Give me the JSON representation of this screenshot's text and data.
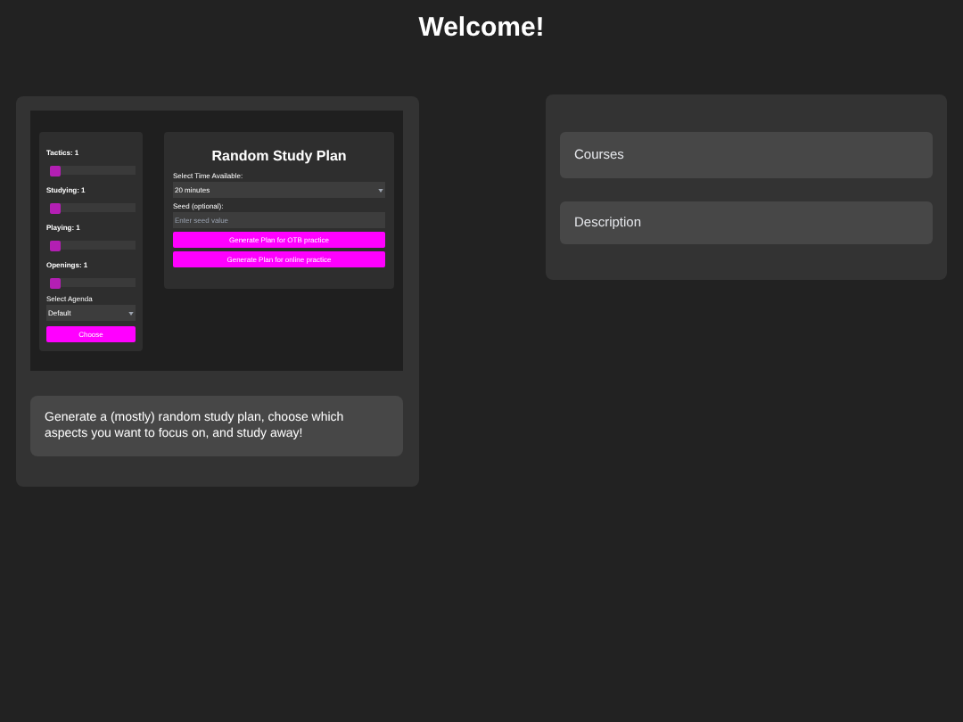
{
  "heading": "Welcome!",
  "preview": {
    "sliders": [
      {
        "label": "Tactics: 1",
        "level": 0
      },
      {
        "label": "Studying: 1",
        "level": 0
      },
      {
        "label": "Playing: 1",
        "level": 0
      },
      {
        "label": "Openings: 1",
        "level": 0
      }
    ],
    "agenda_label": "Select Agenda",
    "agenda_value": "Default",
    "choose_button": "Choose",
    "plan_title": "Random Study Plan",
    "time_label": "Select Time Available:",
    "time_value": "20 minutes",
    "seed_label": "Seed (optional):",
    "seed_placeholder": "Enter seed value",
    "buttons": [
      "Generate Plan for OTB practice",
      "Generate Plan for online practice"
    ]
  },
  "description": "Generate a (mostly) random study plan, choose which aspects you want to focus on, and study away!",
  "links": [
    "Courses",
    "Description"
  ]
}
